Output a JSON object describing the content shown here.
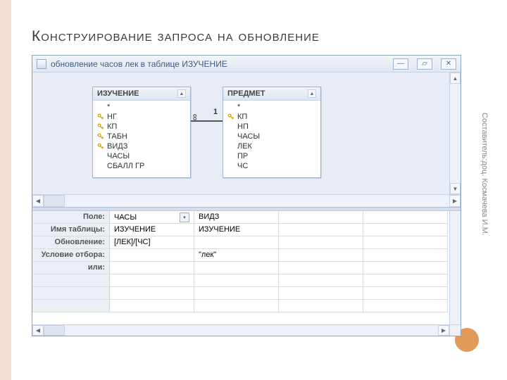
{
  "slide": {
    "title": "Конструирование запроса на обновление",
    "credit": "Составитель:доц. Космачева И.М."
  },
  "window": {
    "title": "обновление часов лек в таблице ИЗУЧЕНИЕ",
    "buttons": {
      "min": "—",
      "max": "▱",
      "close": "✕"
    }
  },
  "tables": {
    "izuchenie": {
      "name": "ИЗУЧЕНИЕ",
      "fields": [
        {
          "name": "*",
          "pk": false
        },
        {
          "name": "НГ",
          "pk": true
        },
        {
          "name": "КП",
          "pk": true
        },
        {
          "name": "ТАБН",
          "pk": true
        },
        {
          "name": "ВИДЗ",
          "pk": true
        },
        {
          "name": "ЧАСЫ",
          "pk": false
        },
        {
          "name": "СБАЛЛ ГР",
          "pk": false
        }
      ]
    },
    "predmet": {
      "name": "ПРЕДМЕТ",
      "fields": [
        {
          "name": "*",
          "pk": false
        },
        {
          "name": "КП",
          "pk": true
        },
        {
          "name": "НП",
          "pk": false
        },
        {
          "name": "ЧАСЫ",
          "pk": false
        },
        {
          "name": "ЛЕК",
          "pk": false
        },
        {
          "name": "ПР",
          "pk": false
        },
        {
          "name": "ЧС",
          "pk": false
        }
      ]
    },
    "relation": {
      "left": "∞",
      "right": "1"
    }
  },
  "grid": {
    "labels": {
      "field": "Поле:",
      "table": "Имя таблицы:",
      "update": "Обновление:",
      "criteria": "Условие отбора:",
      "or": "или:"
    },
    "cols": [
      {
        "field": "ЧАСЫ",
        "table": "ИЗУЧЕНИЕ",
        "update": "[ЛЕК]/[ЧС]",
        "criteria": "",
        "or": ""
      },
      {
        "field": "ВИДЗ",
        "table": "ИЗУЧЕНИЕ",
        "update": "",
        "criteria": "\"лек\"",
        "or": ""
      },
      {
        "field": "",
        "table": "",
        "update": "",
        "criteria": "",
        "or": ""
      },
      {
        "field": "",
        "table": "",
        "update": "",
        "criteria": "",
        "or": ""
      }
    ]
  }
}
